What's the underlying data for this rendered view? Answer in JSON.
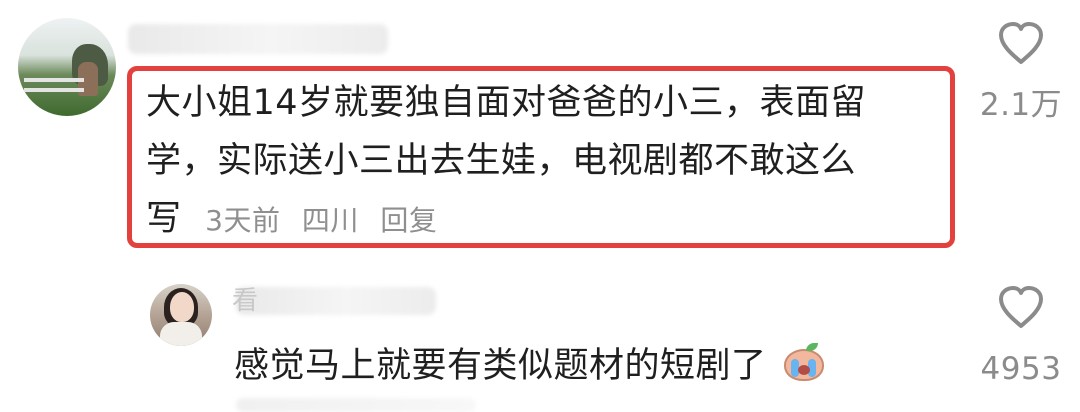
{
  "main_comment": {
    "text_lines": [
      "大小姐14岁就要独自面对爸爸的小三，表面留",
      "学，实际送小三出去生娃，电视剧都不敢这么",
      "写"
    ],
    "time": "3天前",
    "location": "四川",
    "reply_label": "回复",
    "likes": "2.1万",
    "highlight_color": "#e3413d"
  },
  "reply_comment": {
    "name_initial": "看",
    "text": "感觉马上就要有类似题材的短剧了",
    "emoji": "crying-face-icon",
    "likes": "4953"
  },
  "colors": {
    "text": "#1f1f1f",
    "meta": "#8f8f8f",
    "icon": "#8b8b8b"
  }
}
